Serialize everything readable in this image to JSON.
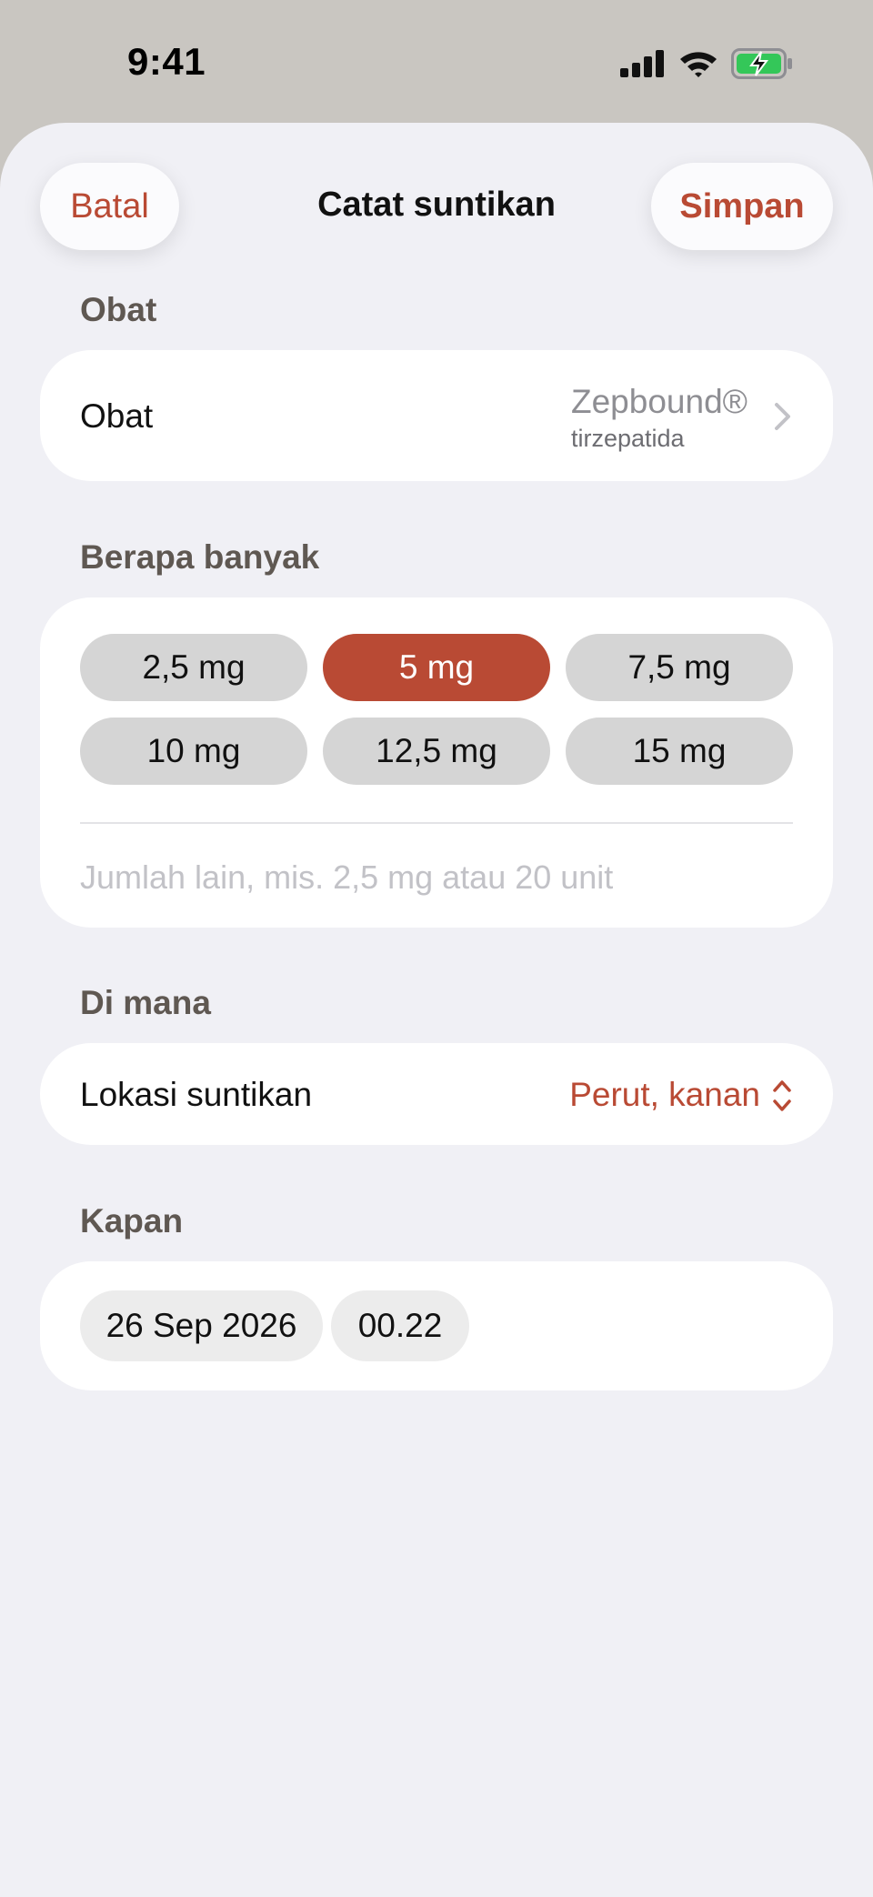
{
  "status_bar": {
    "time": "9:41"
  },
  "nav": {
    "cancel_label": "Batal",
    "title": "Catat suntikan",
    "save_label": "Simpan"
  },
  "medication": {
    "section_title": "Obat",
    "row_label": "Obat",
    "brand_name": "Zepbound®",
    "generic_name": "tirzepatida"
  },
  "dose": {
    "section_title": "Berapa banyak",
    "options": [
      "2,5 mg",
      "5 mg",
      "7,5 mg",
      "10 mg",
      "12,5 mg",
      "15 mg"
    ],
    "selected": "5 mg",
    "other_placeholder": "Jumlah lain, mis. 2,5 mg atau 20 unit"
  },
  "site": {
    "section_title": "Di mana",
    "row_label": "Lokasi suntikan",
    "value": "Perut, kanan"
  },
  "when": {
    "section_title": "Kapan",
    "date": "26 Sep 2026",
    "time": "00.22"
  },
  "colors": {
    "accent": "#b94a34",
    "sheet_bg": "#f0f0f5",
    "backdrop": "#c9c6c1"
  }
}
